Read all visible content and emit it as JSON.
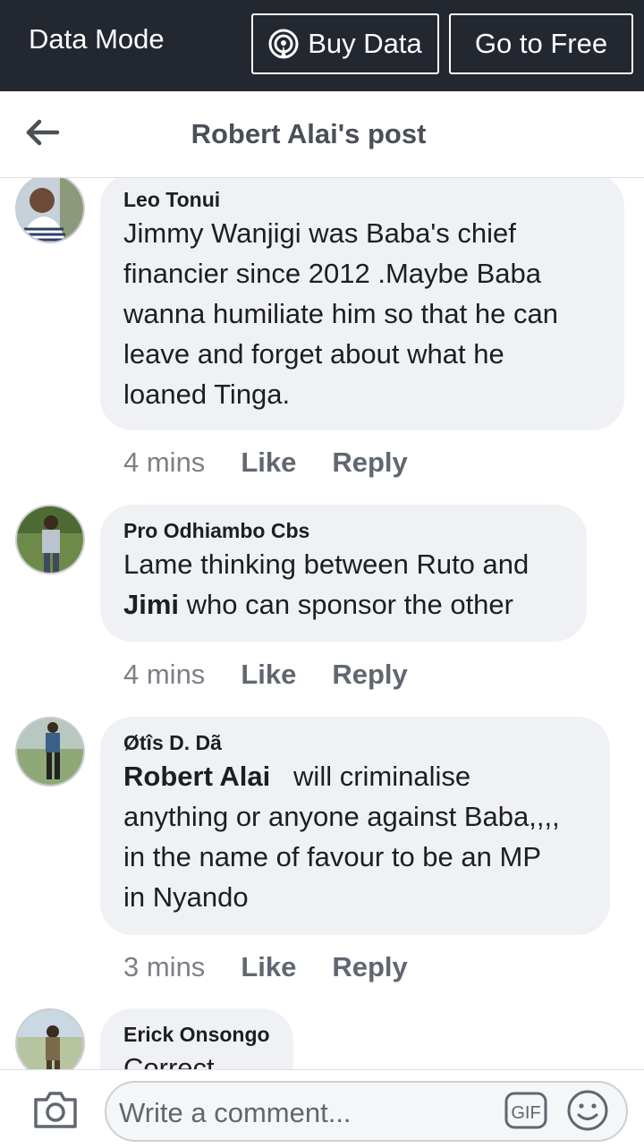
{
  "topbar": {
    "mode_label": "Data Mode",
    "buy_label": "Buy Data",
    "free_label": "Go to Free"
  },
  "header": {
    "title": "Robert Alai's post",
    "back_icon": "arrow-left-icon"
  },
  "comments": [
    {
      "author": "Leo Tonui",
      "lines": [
        "Jimmy Wanjigi was Baba's chief",
        "financier since 2012 .Maybe Baba",
        "wanna humiliate him so that he can",
        "leave and forget about what he",
        "loaned Tinga."
      ],
      "time": "4 mins",
      "like": "Like",
      "reply": "Reply"
    },
    {
      "author": "Pro Odhiambo Cbs",
      "line1": "Lame thinking between Ruto and",
      "mention": "Jimi",
      "line2_rest": " who can sponsor the other",
      "time": "4 mins",
      "like": "Like",
      "reply": "Reply"
    },
    {
      "author": "Øtîs D. Dã",
      "mention": "Robert Alai",
      "line1_rest": "   will criminalise",
      "lines": [
        "anything or anyone against Baba,,,,",
        "in the name of favour to be an MP",
        "in Nyando"
      ],
      "time": "3 mins",
      "like": "Like",
      "reply": "Reply"
    },
    {
      "author": "Erick Onsongo",
      "partial": "Correct"
    }
  ],
  "composer": {
    "placeholder": "Write a comment...",
    "camera_icon": "camera-icon",
    "gif_label": "GIF",
    "emoji_icon": "smiley-icon"
  },
  "colors": {
    "topbar_bg": "#232730",
    "bubble_bg": "#f0f1f5",
    "muted_text": "#606770"
  }
}
